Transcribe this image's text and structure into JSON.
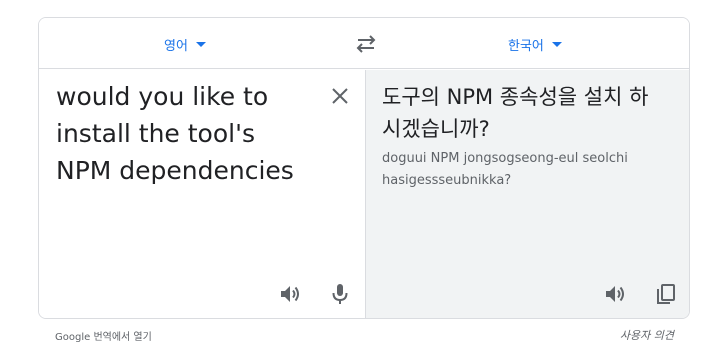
{
  "languages": {
    "source": "영어",
    "target": "한국어"
  },
  "source": {
    "lines": [
      "would you like to",
      "install the tool's",
      "NPM dependencies"
    ]
  },
  "translation": {
    "lines": [
      "도구의 NPM 종속성을 설치 하",
      "시겠습니까?"
    ],
    "romanization_lines": [
      "doguui NPM jongsogseong-eul seolchi",
      "hasigessseubnikka?"
    ]
  },
  "footer": {
    "open_in_translate": "Google 번역에서 열기",
    "feedback": "사용자 의견"
  },
  "icons": {
    "swap": "swap-arrows-icon",
    "clear": "close-icon",
    "listen_source": "speaker-icon",
    "mic": "microphone-icon",
    "listen_target": "speaker-icon",
    "copy": "copy-icon"
  },
  "colors": {
    "accent": "#1a73e8",
    "border": "#dadce0",
    "target_bg": "#f1f3f4",
    "icon": "#5f6368"
  }
}
